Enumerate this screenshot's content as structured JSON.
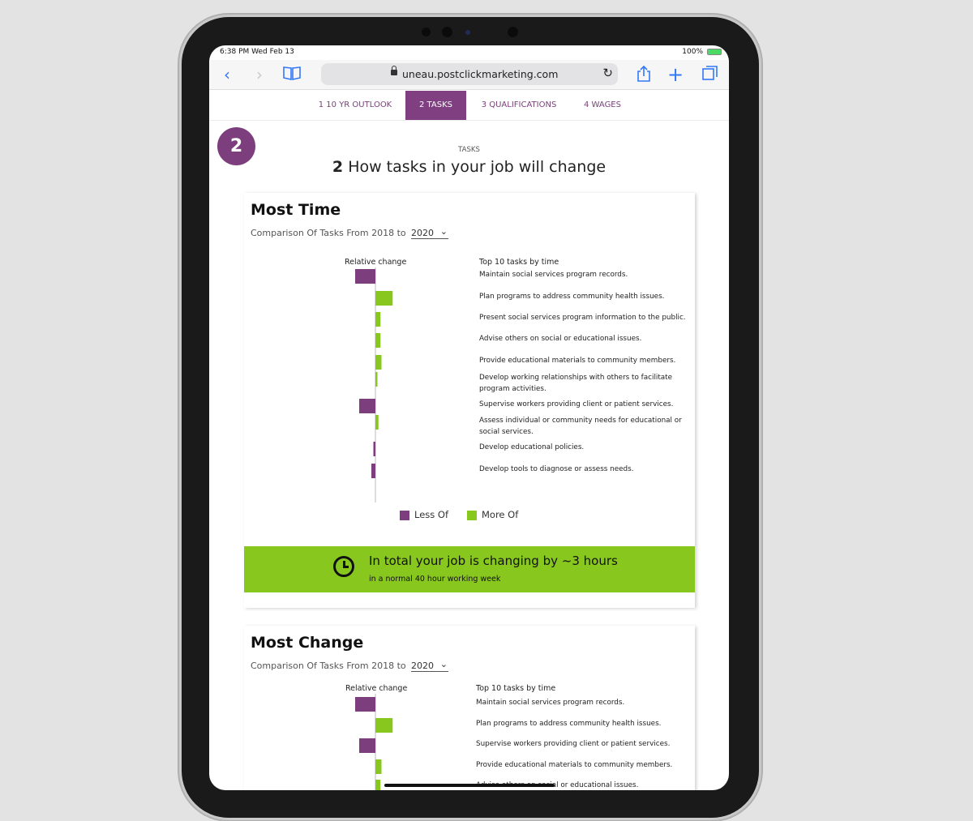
{
  "status_bar": {
    "time": "6:38 PM   Wed Feb 13",
    "battery": "100%"
  },
  "browser": {
    "url": "uneau.postclickmarketing.com",
    "icons": [
      "back-chevron-icon",
      "forward-chevron-icon",
      "bookmarks-book-icon",
      "lock-icon",
      "reload-icon",
      "share-icon",
      "new-tab-plus-icon",
      "tabs-overview-icon"
    ]
  },
  "tabs": [
    {
      "label": "1 10 YR OUTLOOK",
      "active": false
    },
    {
      "label": "2 TASKS",
      "active": true
    },
    {
      "label": "3 QUALIFICATIONS",
      "active": false
    },
    {
      "label": "4 WAGES",
      "active": false
    }
  ],
  "section": {
    "number": "2",
    "kicker": "TASKS",
    "heading_num": "2",
    "heading_text": "How tasks in your job will change"
  },
  "colors": {
    "less": "#7d3e7e",
    "more": "#88c81e",
    "accent": "#7f3f80"
  },
  "card1": {
    "title": "Most Time",
    "subtitle": "Comparison Of Tasks From 2018 to",
    "year": "2020",
    "rel_label": "Relative change",
    "tasks_label": "Top 10 tasks by time",
    "legend_less": "Less Of",
    "legend_more": "More Of",
    "banner_main": "In total your job is changing by ~3 hours",
    "banner_sub": "in a normal 40 hour working week"
  },
  "card2": {
    "title": "Most Change",
    "subtitle": "Comparison Of Tasks From 2018 to",
    "year": "2020",
    "rel_label": "Relative change",
    "tasks_label": "Top 10 tasks by time"
  },
  "chart_data": [
    {
      "type": "bar",
      "title": "Most Time",
      "orientation": "horizontal-diverging",
      "categories": [
        "Maintain social services program records.",
        "Plan programs to address community health issues.",
        "Present social services program information to the public.",
        "Advise others on social or educational issues.",
        "Provide educational materials to community members.",
        "Develop working relationships with others to facilitate program activities.",
        "Supervise workers providing client or patient services.",
        "Assess individual or community needs for educational or social services.",
        "Develop educational policies.",
        "Develop tools to diagnose or assess needs."
      ],
      "values": [
        -1.0,
        0.85,
        0.25,
        0.25,
        0.3,
        0.1,
        -0.8,
        0.15,
        -0.1,
        -0.2
      ],
      "xlabel": "Relative change",
      "legend": [
        "Less Of",
        "More Of"
      ]
    },
    {
      "type": "bar",
      "title": "Most Change",
      "orientation": "horizontal-diverging",
      "categories": [
        "Maintain social services program records.",
        "Plan programs to address community health issues.",
        "Supervise workers providing client or patient services.",
        "Provide educational materials to community members.",
        "Advise others on social or educational issues."
      ],
      "values": [
        -1.0,
        0.85,
        -0.8,
        0.3,
        0.25
      ],
      "xlabel": "Relative change"
    }
  ]
}
